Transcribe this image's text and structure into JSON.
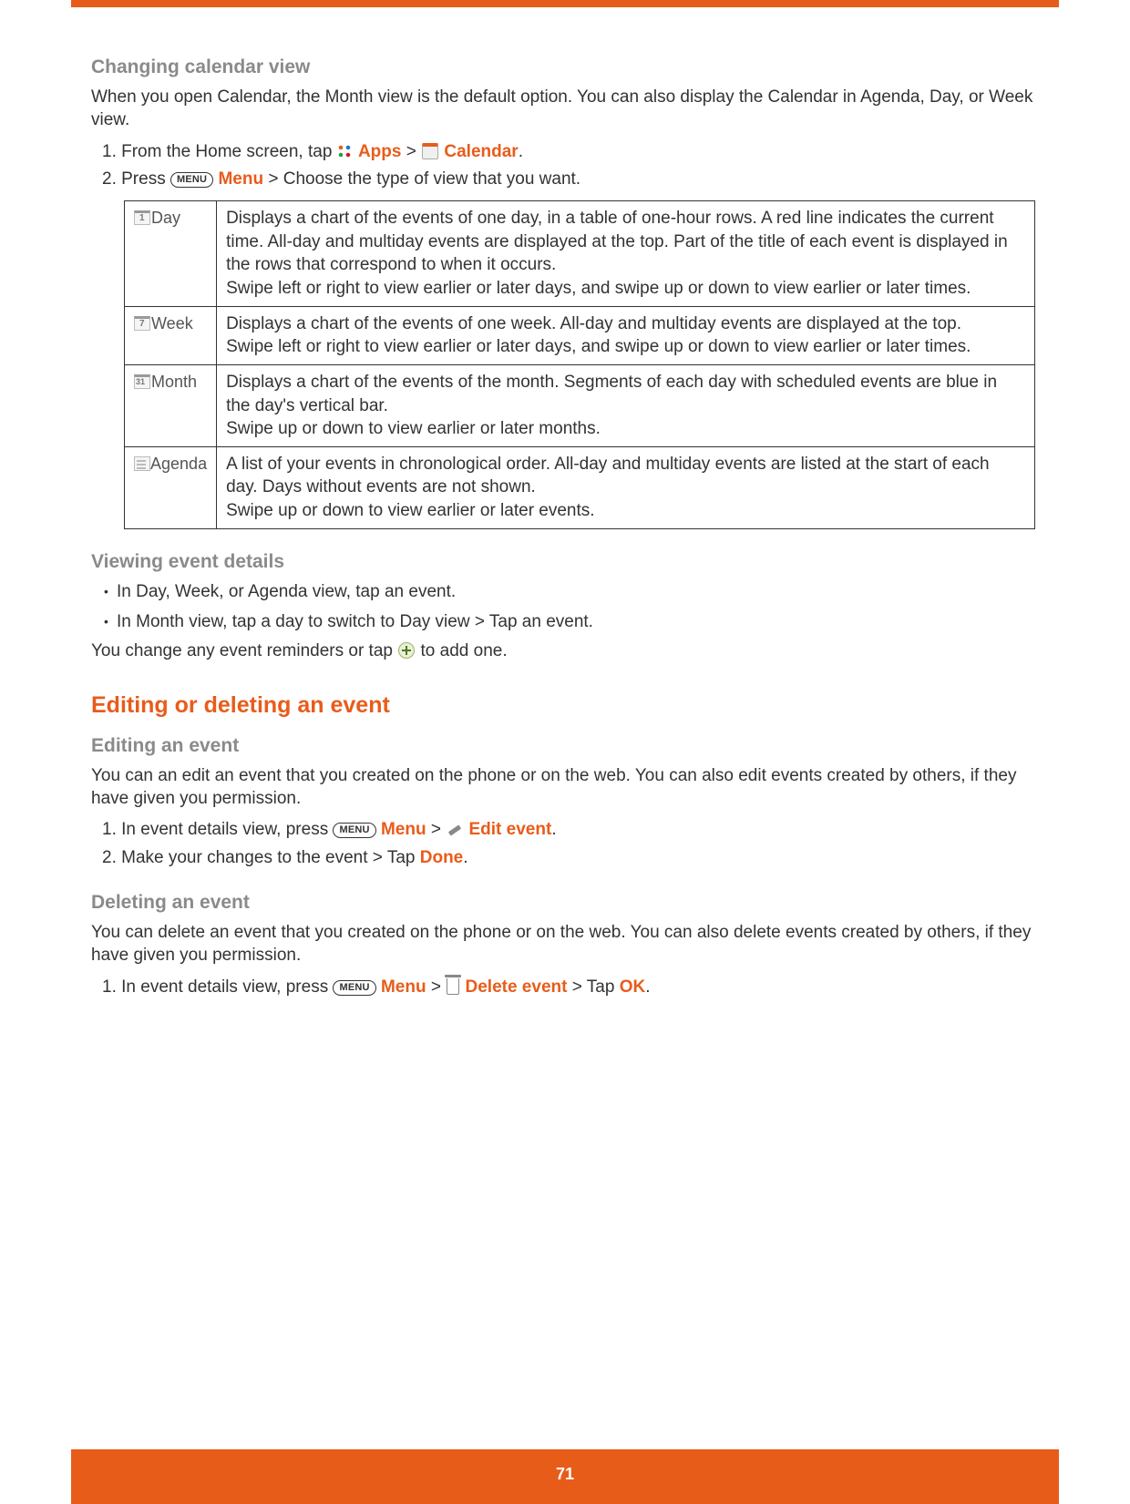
{
  "page_number": "71",
  "sections": {
    "changing_view": {
      "heading": "Changing calendar view",
      "intro": "When you open Calendar, the Month view is the default option. You can also display the Calendar in Agenda, Day, or Week view.",
      "step1_prefix": "1. From the Home screen, tap ",
      "apps_label": "Apps",
      "gt": " > ",
      "calendar_label": "Calendar",
      "step1_suffix": ".",
      "step2_prefix": "2. Press ",
      "menu_key": "MENU",
      "menu_label": "Menu",
      "step2_suffix": " > Choose the type of view that you want."
    },
    "table": {
      "rows": [
        {
          "label": "Day",
          "desc": "Displays a chart of the events of one day, in a table of one-hour rows. A red line indicates the current time. All-day and multiday events are displayed at the top. Part of the title of each event is displayed in the rows that correspond to when it occurs.\nSwipe left or right to view earlier or later days, and swipe up or down to view earlier or later times."
        },
        {
          "label": "Week",
          "desc": "Displays a chart of the events of one week. All-day and multiday events are displayed at the top.\nSwipe left or right to view earlier or later days, and swipe up or down to view earlier or later times."
        },
        {
          "label": "Month",
          "desc": "Displays a chart of the events of the month. Segments of each day with scheduled events are blue in the day's vertical bar.\nSwipe up or down to view earlier or later months."
        },
        {
          "label": "Agenda",
          "desc": "A list of your events in chronological order. All-day and multiday events are listed at the start of each day. Days without events are not shown.\nSwipe up or down to view earlier or later events."
        }
      ]
    },
    "viewing_details": {
      "heading": "Viewing event details",
      "b1": "In Day, Week, or Agenda view, tap an event.",
      "b2": "In Month view, tap a day to switch to Day view > Tap an event.",
      "reminders_prefix": "You change any event reminders or tap ",
      "reminders_suffix": " to add one."
    },
    "editing_deleting": {
      "heading": "Editing or deleting an event"
    },
    "editing": {
      "heading": "Editing an event",
      "intro": "You can an edit an event that you created on the phone or on the web. You can also edit events created by others, if they have given you permission.",
      "step1_prefix": "1. In event details view, press ",
      "menu_key": "MENU",
      "menu_label": "Menu",
      "gt": " > ",
      "edit_label": "Edit event",
      "step1_suffix": ".",
      "step2_prefix": "2. Make your changes to the event > Tap ",
      "done_label": "Done",
      "step2_suffix": "."
    },
    "deleting": {
      "heading": "Deleting an event",
      "intro": "You can delete an event that you created on the phone or on the web. You can also delete events created by others, if they have given you permission.",
      "step1_prefix": "1. In event details view, press ",
      "menu_key": "MENU",
      "menu_label": "Menu",
      "gt": " > ",
      "delete_label": "Delete event ",
      "tap_prefix": " > Tap ",
      "ok_label": "OK",
      "step1_suffix": "."
    }
  }
}
